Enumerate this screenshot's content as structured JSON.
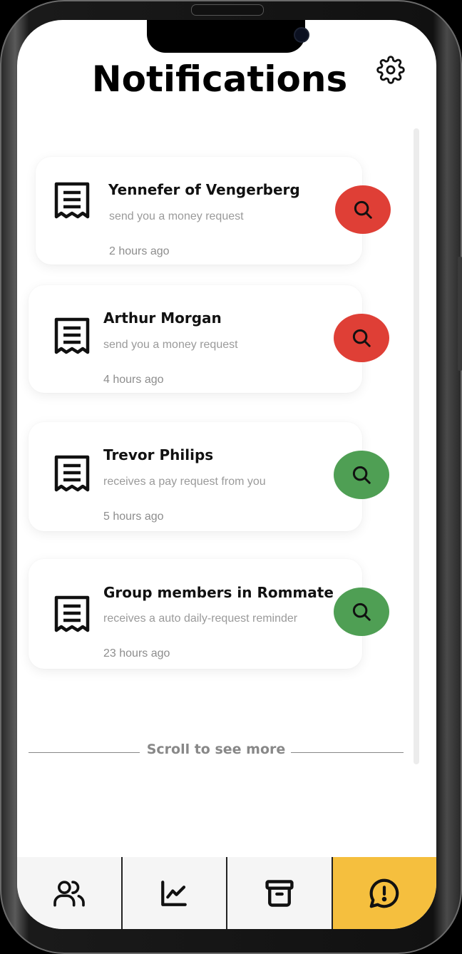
{
  "header": {
    "title": "Notifications",
    "settings_icon": "gear-icon"
  },
  "notifications": [
    {
      "name": "Yennefer of Vengerberg",
      "message": "send you a money request",
      "time": "2 hours ago",
      "action_color": "#df3f36",
      "icon": "receipt-icon"
    },
    {
      "name": "Arthur Morgan",
      "message": "send you a money request",
      "time": "4 hours ago",
      "action_color": "#df3f36",
      "icon": "receipt-icon"
    },
    {
      "name": "Trevor Philips",
      "message": "receives a pay request from you",
      "time": "5 hours ago",
      "action_color": "#4f9f54",
      "icon": "receipt-icon"
    },
    {
      "name": "Group members in Rommate",
      "message": "receives a auto daily-request reminder",
      "time": "23 hours ago",
      "action_color": "#4f9f54",
      "icon": "receipt-icon"
    }
  ],
  "scroll_hint": "Scroll to see more",
  "tabbar": {
    "tabs": [
      {
        "icon": "users-icon",
        "active": false
      },
      {
        "icon": "chart-line-icon",
        "active": false
      },
      {
        "icon": "archive-icon",
        "active": false
      },
      {
        "icon": "alert-message-icon",
        "active": true
      }
    ],
    "active_color": "#f5bf3e"
  }
}
